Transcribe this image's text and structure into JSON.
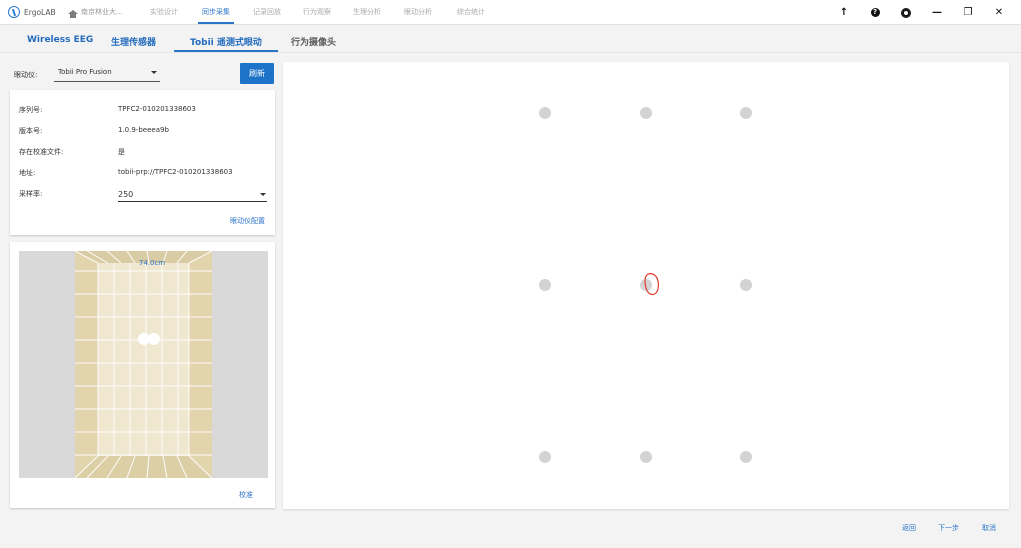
{
  "app": {
    "title": "ErgoLAB"
  },
  "top_nav": {
    "home_label": "南京林业大...",
    "tabs": [
      {
        "label": "实验设计"
      },
      {
        "label": "同步采集",
        "active": true
      },
      {
        "label": "记录回放"
      },
      {
        "label": "行为观察"
      },
      {
        "label": "生理分析"
      },
      {
        "label": "眼动分析"
      },
      {
        "label": "综合统计"
      }
    ]
  },
  "window_tools": {
    "upload": "↑",
    "help": "?",
    "settings": "settings",
    "minimize": "—",
    "restore": "❐",
    "close": "✕"
  },
  "secondary_tabs": [
    {
      "label": "Wireless EEG"
    },
    {
      "label": "生理传感器"
    },
    {
      "label": "Tobii 遥测式眼动",
      "active": true
    },
    {
      "label": "行为摄像头"
    }
  ],
  "device_selector": {
    "label": "眼动仪:",
    "selected": "Tobii Pro Fusion"
  },
  "refresh_button": {
    "label": "刷新"
  },
  "device_info": {
    "serial_label": "序列号:",
    "serial_value": "TPFC2-010201338603",
    "version_label": "版本号:",
    "version_value": "1.0.9-beeea9b",
    "calibration_file_label": "存在校准文件:",
    "calibration_file_value": "是",
    "address_label": "地址:",
    "address_value": "tobii-prp://TPFC2-010201338603",
    "sample_rate_label": "采样率:",
    "sample_rate_value": "250",
    "config_link": "眼动仪配置"
  },
  "track_box": {
    "distance_label": "74.0cm",
    "calibrate_link": "校准"
  },
  "calibration_points": [
    {
      "row": 1,
      "column": 1
    },
    {
      "row": 1,
      "column": 2
    },
    {
      "row": 1,
      "column": 3
    },
    {
      "row": 2,
      "column": 1
    },
    {
      "row": 2,
      "column": 2,
      "active": true
    },
    {
      "row": 2,
      "column": 3
    },
    {
      "row": 3,
      "column": 1
    },
    {
      "row": 3,
      "column": 2
    },
    {
      "row": 3,
      "column": 3
    }
  ],
  "bottom_buttons": {
    "back": "返回",
    "next": "下一步",
    "cancel": "取消"
  },
  "colors": {
    "primary_blue": "#1c73c7",
    "active_tab_blue": "#2a75c8",
    "gaze_marker_red": "#e33b2d",
    "track_box_fill": "#e8dfc0"
  }
}
